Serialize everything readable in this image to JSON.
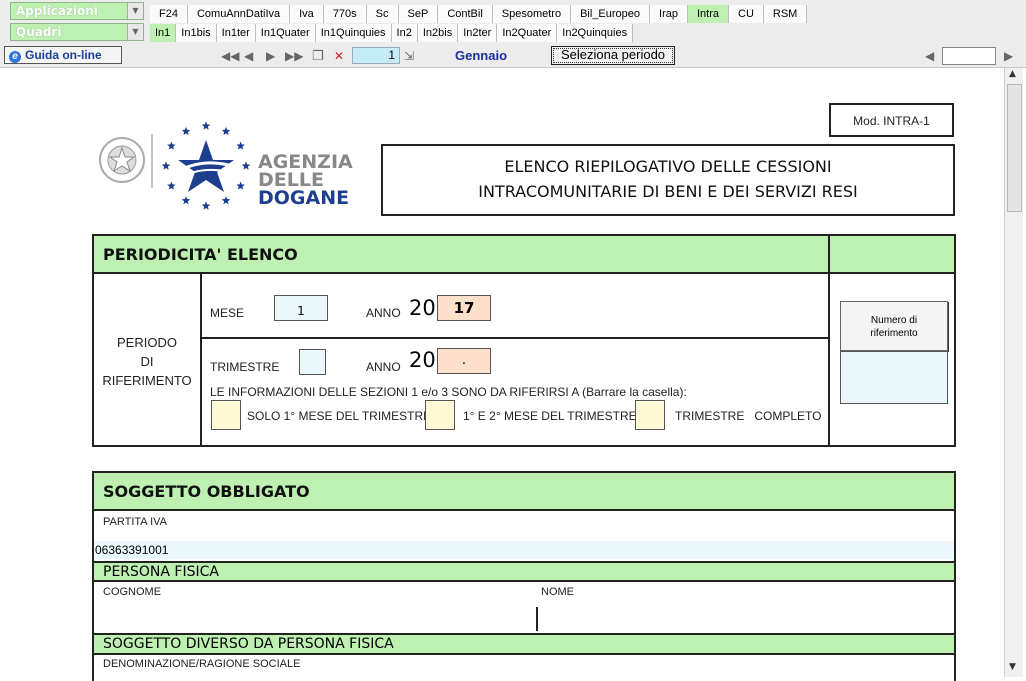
{
  "top": {
    "applicazioni_label": "Applicazioni",
    "quadri_label": "Quadri",
    "main_tabs": [
      "F24",
      "ComuAnnDatiIva",
      "Iva",
      "770s",
      "Sc",
      "SeP",
      "ContBil",
      "Spesometro",
      "Bil_Europeo",
      "Irap",
      "Intra",
      "CU",
      "RSM"
    ],
    "sub_tabs": [
      "In1",
      "In1bis",
      "In1ter",
      "In1Quater",
      "In1Quinquies",
      "In2",
      "In2bis",
      "In2ter",
      "In2Quater",
      "In2Quinquies"
    ]
  },
  "nav": {
    "guida_label": "Guida on-line",
    "page_value": "1",
    "month": "Gennaio",
    "select_period_label": "Seleziona periodo"
  },
  "doc": {
    "mod": "Mod. INTRA-1",
    "logo": {
      "line1": "AGENZIA",
      "line2": "DELLE",
      "line3": "DOGANE"
    },
    "title_line1": "ELENCO RIEPILOGATIVO DELLE CESSIONI",
    "title_line2": "INTRACOMUNITARIE DI BENI E DEI SERVIZI RESI",
    "periodicita": {
      "header": "PERIODICITA' ELENCO",
      "periodo_line1": "PERIODO",
      "periodo_line2": "DI",
      "periodo_line3": "RIFERIMENTO",
      "mese_label": "MESE",
      "mese_value": "1",
      "anno_label": "ANNO",
      "anno_prefix": "20",
      "anno_value": "17",
      "trimestre_label": "TRIMESTRE",
      "anno2_value": ".",
      "info": "LE INFORMAZIONI DELLE SEZIONI 1 e/o 3 SONO DA RIFERIRSI A (Barrare la casella):",
      "opt1": "SOLO 1° MESE DEL TRIMESTRE",
      "opt2": "1° E 2° MESE DEL TRIMESTRE",
      "opt3": "TRIMESTRE   COMPLETO",
      "numero_line1": "Numero di",
      "numero_line2": "riferimento"
    },
    "soggetto": {
      "header": "SOGGETTO OBBLIGATO",
      "partita_iva_label": "PARTITA IVA",
      "partita_iva_value": "06363391001",
      "persona_fisica": "PERSONA FISICA",
      "cognome": "COGNOME",
      "nome": "NOME",
      "diverso": "SOGGETTO DIVERSO DA PERSONA FISICA",
      "denominazione": "DENOMINAZIONE/RAGIONE SOCIALE"
    }
  }
}
